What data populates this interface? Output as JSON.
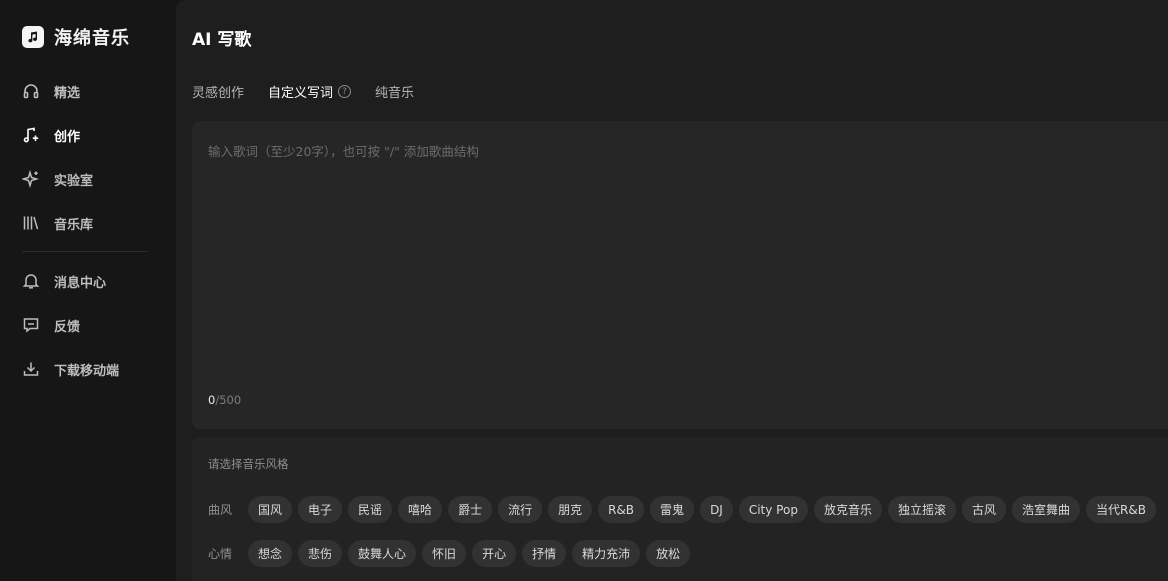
{
  "brand": {
    "name": "海绵音乐",
    "icon": "music-note-icon"
  },
  "nav": {
    "items": [
      {
        "label": "精选",
        "icon": "headphones-icon"
      },
      {
        "label": "创作",
        "icon": "music-sparkle-icon"
      },
      {
        "label": "实验室",
        "icon": "sparkle-icon"
      },
      {
        "label": "音乐库",
        "icon": "library-icon"
      },
      {
        "label": "消息中心",
        "icon": "bell-icon"
      },
      {
        "label": "反馈",
        "icon": "feedback-icon"
      },
      {
        "label": "下载移动端",
        "icon": "download-icon"
      }
    ],
    "active": "创作"
  },
  "page": {
    "title": "AI 写歌"
  },
  "tabs": [
    {
      "label": "灵感创作"
    },
    {
      "label": "自定义写词",
      "icon": "help-icon",
      "icon_text": "?"
    },
    {
      "label": "纯音乐"
    }
  ],
  "lyrics": {
    "placeholder": "输入歌词（至少20字），也可按 \"/\" 添加歌曲结构",
    "value": "",
    "count": "0",
    "max": "/500"
  },
  "style": {
    "title": "请选择音乐风格",
    "genre_label": "曲风",
    "genres": [
      "国风",
      "电子",
      "民谣",
      "嘻哈",
      "爵士",
      "流行",
      "朋克",
      "R&B",
      "雷鬼",
      "DJ",
      "City Pop",
      "放克音乐",
      "独立摇滚",
      "古风",
      "浩室舞曲",
      "当代R&B"
    ],
    "mood_label": "心情",
    "moods": [
      "想念",
      "悲伤",
      "鼓舞人心",
      "怀旧",
      "开心",
      "抒情",
      "精力充沛",
      "放松"
    ]
  },
  "colors": {
    "background": "#161616",
    "panel": "#1e1e1e",
    "input": "#262626",
    "tag": "#323232",
    "text": "#ffffff"
  }
}
